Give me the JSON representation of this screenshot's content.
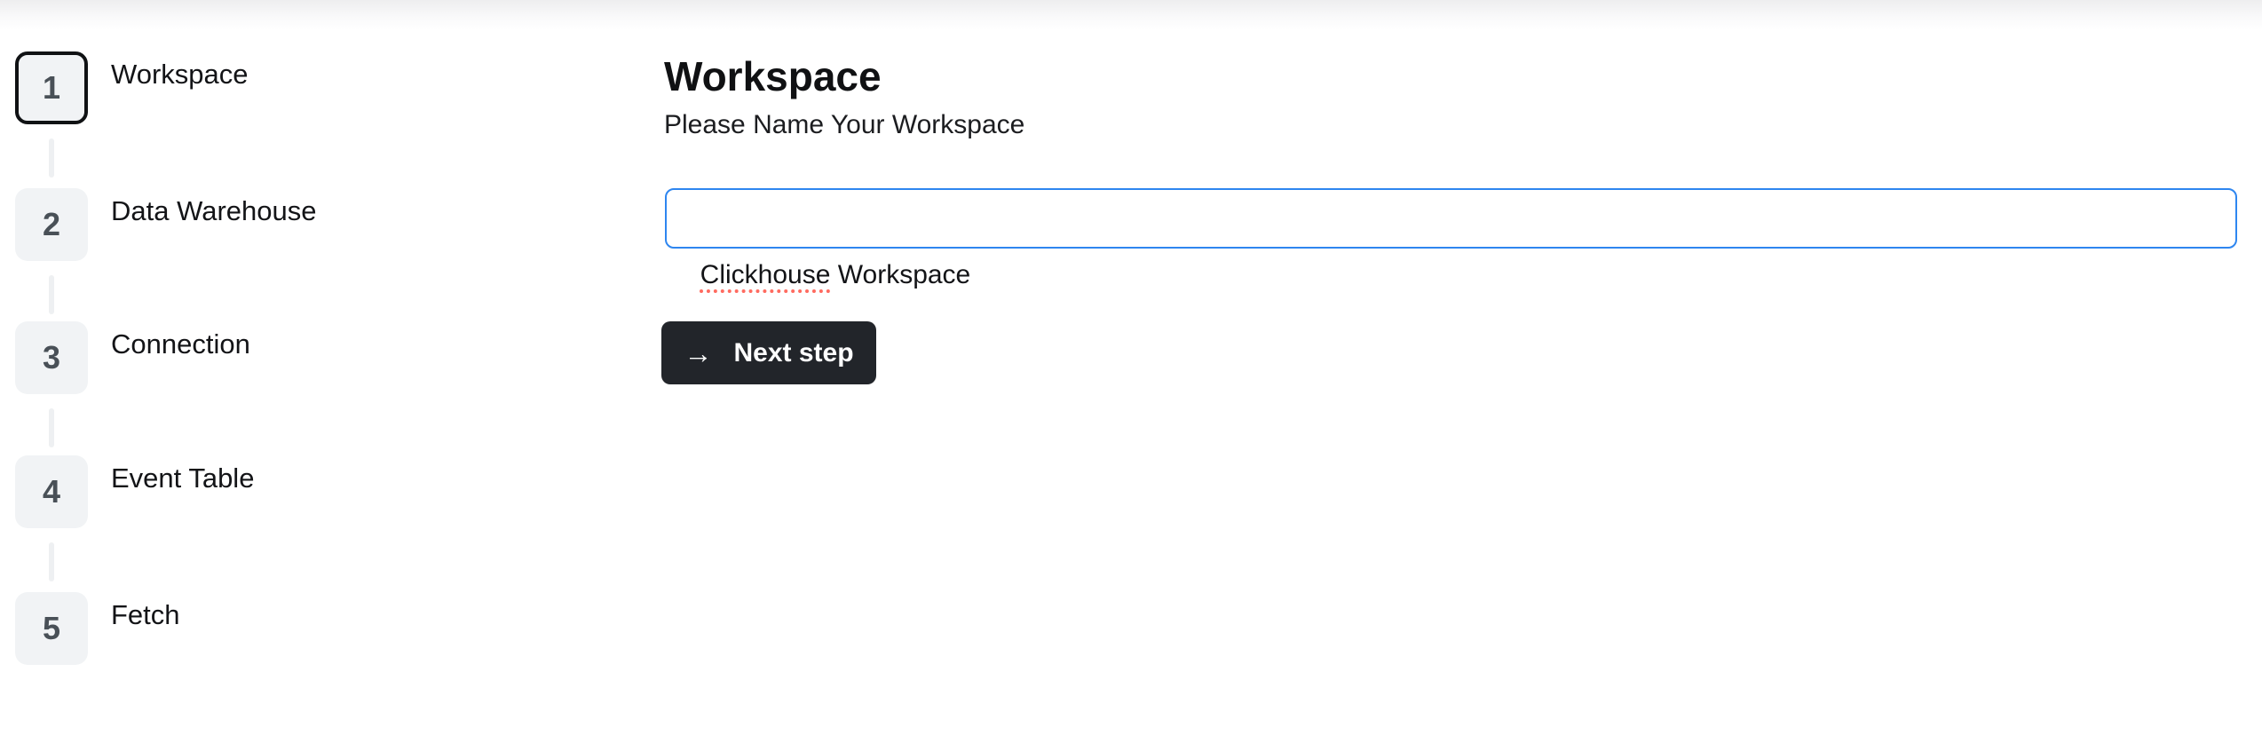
{
  "stepper": {
    "steps": [
      {
        "number": "1",
        "label": "Workspace",
        "state": "active"
      },
      {
        "number": "2",
        "label": "Data Warehouse",
        "state": "upcoming"
      },
      {
        "number": "3",
        "label": "Connection",
        "state": "upcoming"
      },
      {
        "number": "4",
        "label": "Event Table",
        "state": "upcoming"
      },
      {
        "number": "5",
        "label": "Fetch",
        "state": "upcoming"
      }
    ]
  },
  "main": {
    "title": "Workspace",
    "subtitle": "Please Name Your Workspace",
    "input": {
      "value": "Clickhouse Workspace",
      "misspelled_segment": "Clickhouse",
      "rest_segment": " Workspace"
    },
    "next_button": {
      "label": "Next step",
      "arrow_icon": "→"
    }
  },
  "colors": {
    "input_focus_border": "#2e86f0",
    "spellcheck_underline": "#ff6b60",
    "button_background": "#22252a",
    "button_text": "#ffffff",
    "badge_background": "#f1f3f5",
    "badge_number": "#495057",
    "active_badge_border": "#101214",
    "connector": "#eef0f2"
  }
}
